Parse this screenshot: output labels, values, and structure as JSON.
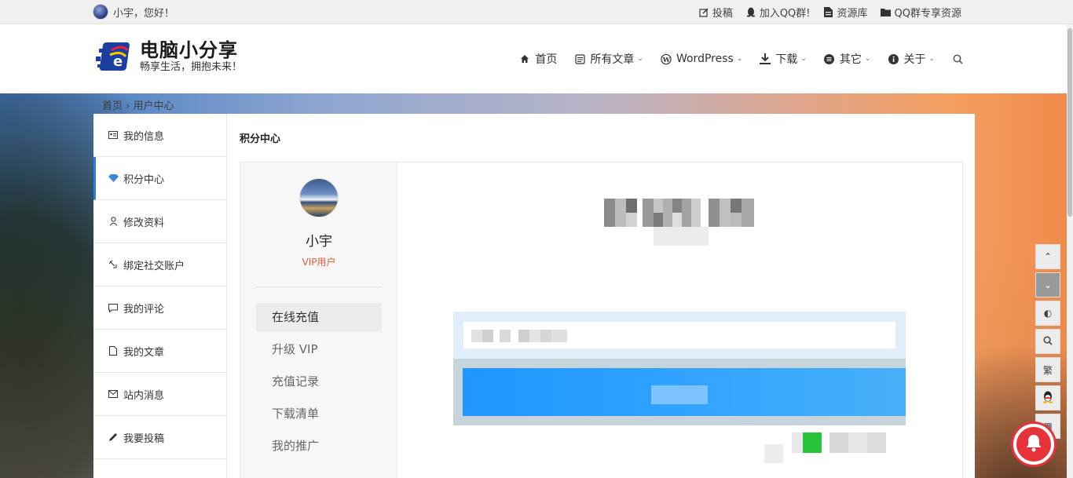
{
  "topbar": {
    "greeting": "小宇，您好！",
    "links": [
      {
        "label": "投稿",
        "icon": "edit-icon"
      },
      {
        "label": "加入QQ群!",
        "icon": "qq-icon"
      },
      {
        "label": "资源库",
        "icon": "document-icon"
      },
      {
        "label": "QQ群专享资源",
        "icon": "folder-icon"
      }
    ]
  },
  "header": {
    "site_title": "电脑小分享",
    "site_subtitle": "畅享生活，拥抱未来！",
    "nav": [
      {
        "label": "首页",
        "icon": "home-icon",
        "dropdown": false
      },
      {
        "label": "所有文章",
        "icon": "article-icon",
        "dropdown": true
      },
      {
        "label": "WordPress",
        "icon": "wordpress-icon",
        "dropdown": true
      },
      {
        "label": "下载",
        "icon": "download-icon",
        "dropdown": true
      },
      {
        "label": "其它",
        "icon": "more-icon",
        "dropdown": true
      },
      {
        "label": "关于",
        "icon": "info-icon",
        "dropdown": true
      }
    ]
  },
  "breadcrumb": {
    "home": "首页",
    "separator": "›",
    "current": "用户中心"
  },
  "side_menu": {
    "items": [
      {
        "label": "我的信息",
        "icon": "id-card-icon"
      },
      {
        "label": "积分中心",
        "icon": "diamond-icon"
      },
      {
        "label": "修改资料",
        "icon": "user-icon"
      },
      {
        "label": "绑定社交账户",
        "icon": "link-icon"
      },
      {
        "label": "我的评论",
        "icon": "comment-icon"
      },
      {
        "label": "我的文章",
        "icon": "file-icon"
      },
      {
        "label": "站内消息",
        "icon": "mail-icon"
      },
      {
        "label": "我要投稿",
        "icon": "pencil-icon"
      }
    ],
    "active_index": 1
  },
  "main": {
    "title": "积分中心",
    "profile": {
      "name": "小宇",
      "badge": "VIP用户",
      "menu": [
        {
          "label": "在线充值"
        },
        {
          "label": "升级 VIP"
        },
        {
          "label": "充值记录"
        },
        {
          "label": "下载清单"
        },
        {
          "label": "我的推广"
        }
      ],
      "active_index": 0
    }
  },
  "tools": {
    "items": [
      {
        "icon": "chevron-up-icon",
        "glyph": "⌃"
      },
      {
        "icon": "chevron-down-icon",
        "glyph": "⌄"
      },
      {
        "icon": "contrast-icon",
        "glyph": "◐"
      },
      {
        "icon": "search-icon",
        "glyph": "⚲"
      },
      {
        "icon": "traditional-chinese-icon",
        "glyph": "繁"
      },
      {
        "icon": "qq-icon",
        "glyph": "☗"
      },
      {
        "icon": "qrcode-icon",
        "glyph": "▦"
      }
    ]
  },
  "colors": {
    "accent": "#2a7de1",
    "vip": "#e25b35",
    "pay_button": "#1f96ff",
    "bell": "#e8323a"
  }
}
